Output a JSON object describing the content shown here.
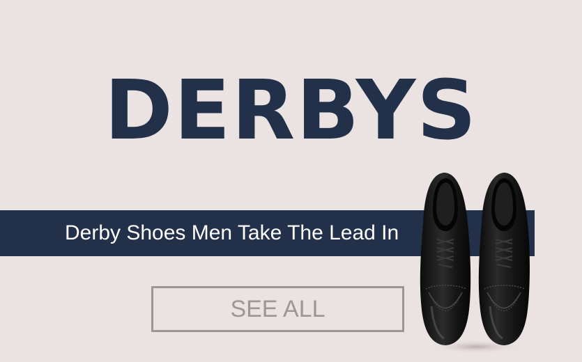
{
  "banner": {
    "headline": "DERBYS",
    "subtitle": "Derby Shoes Men Take The Lead In",
    "cta_label": "SEE ALL"
  },
  "colors": {
    "background": "#ebe2e2",
    "navy": "#22304a",
    "button_border": "#9b9797",
    "shoe": "#1b1b1b"
  },
  "image": {
    "subject": "pair-of-black-derby-shoes"
  }
}
